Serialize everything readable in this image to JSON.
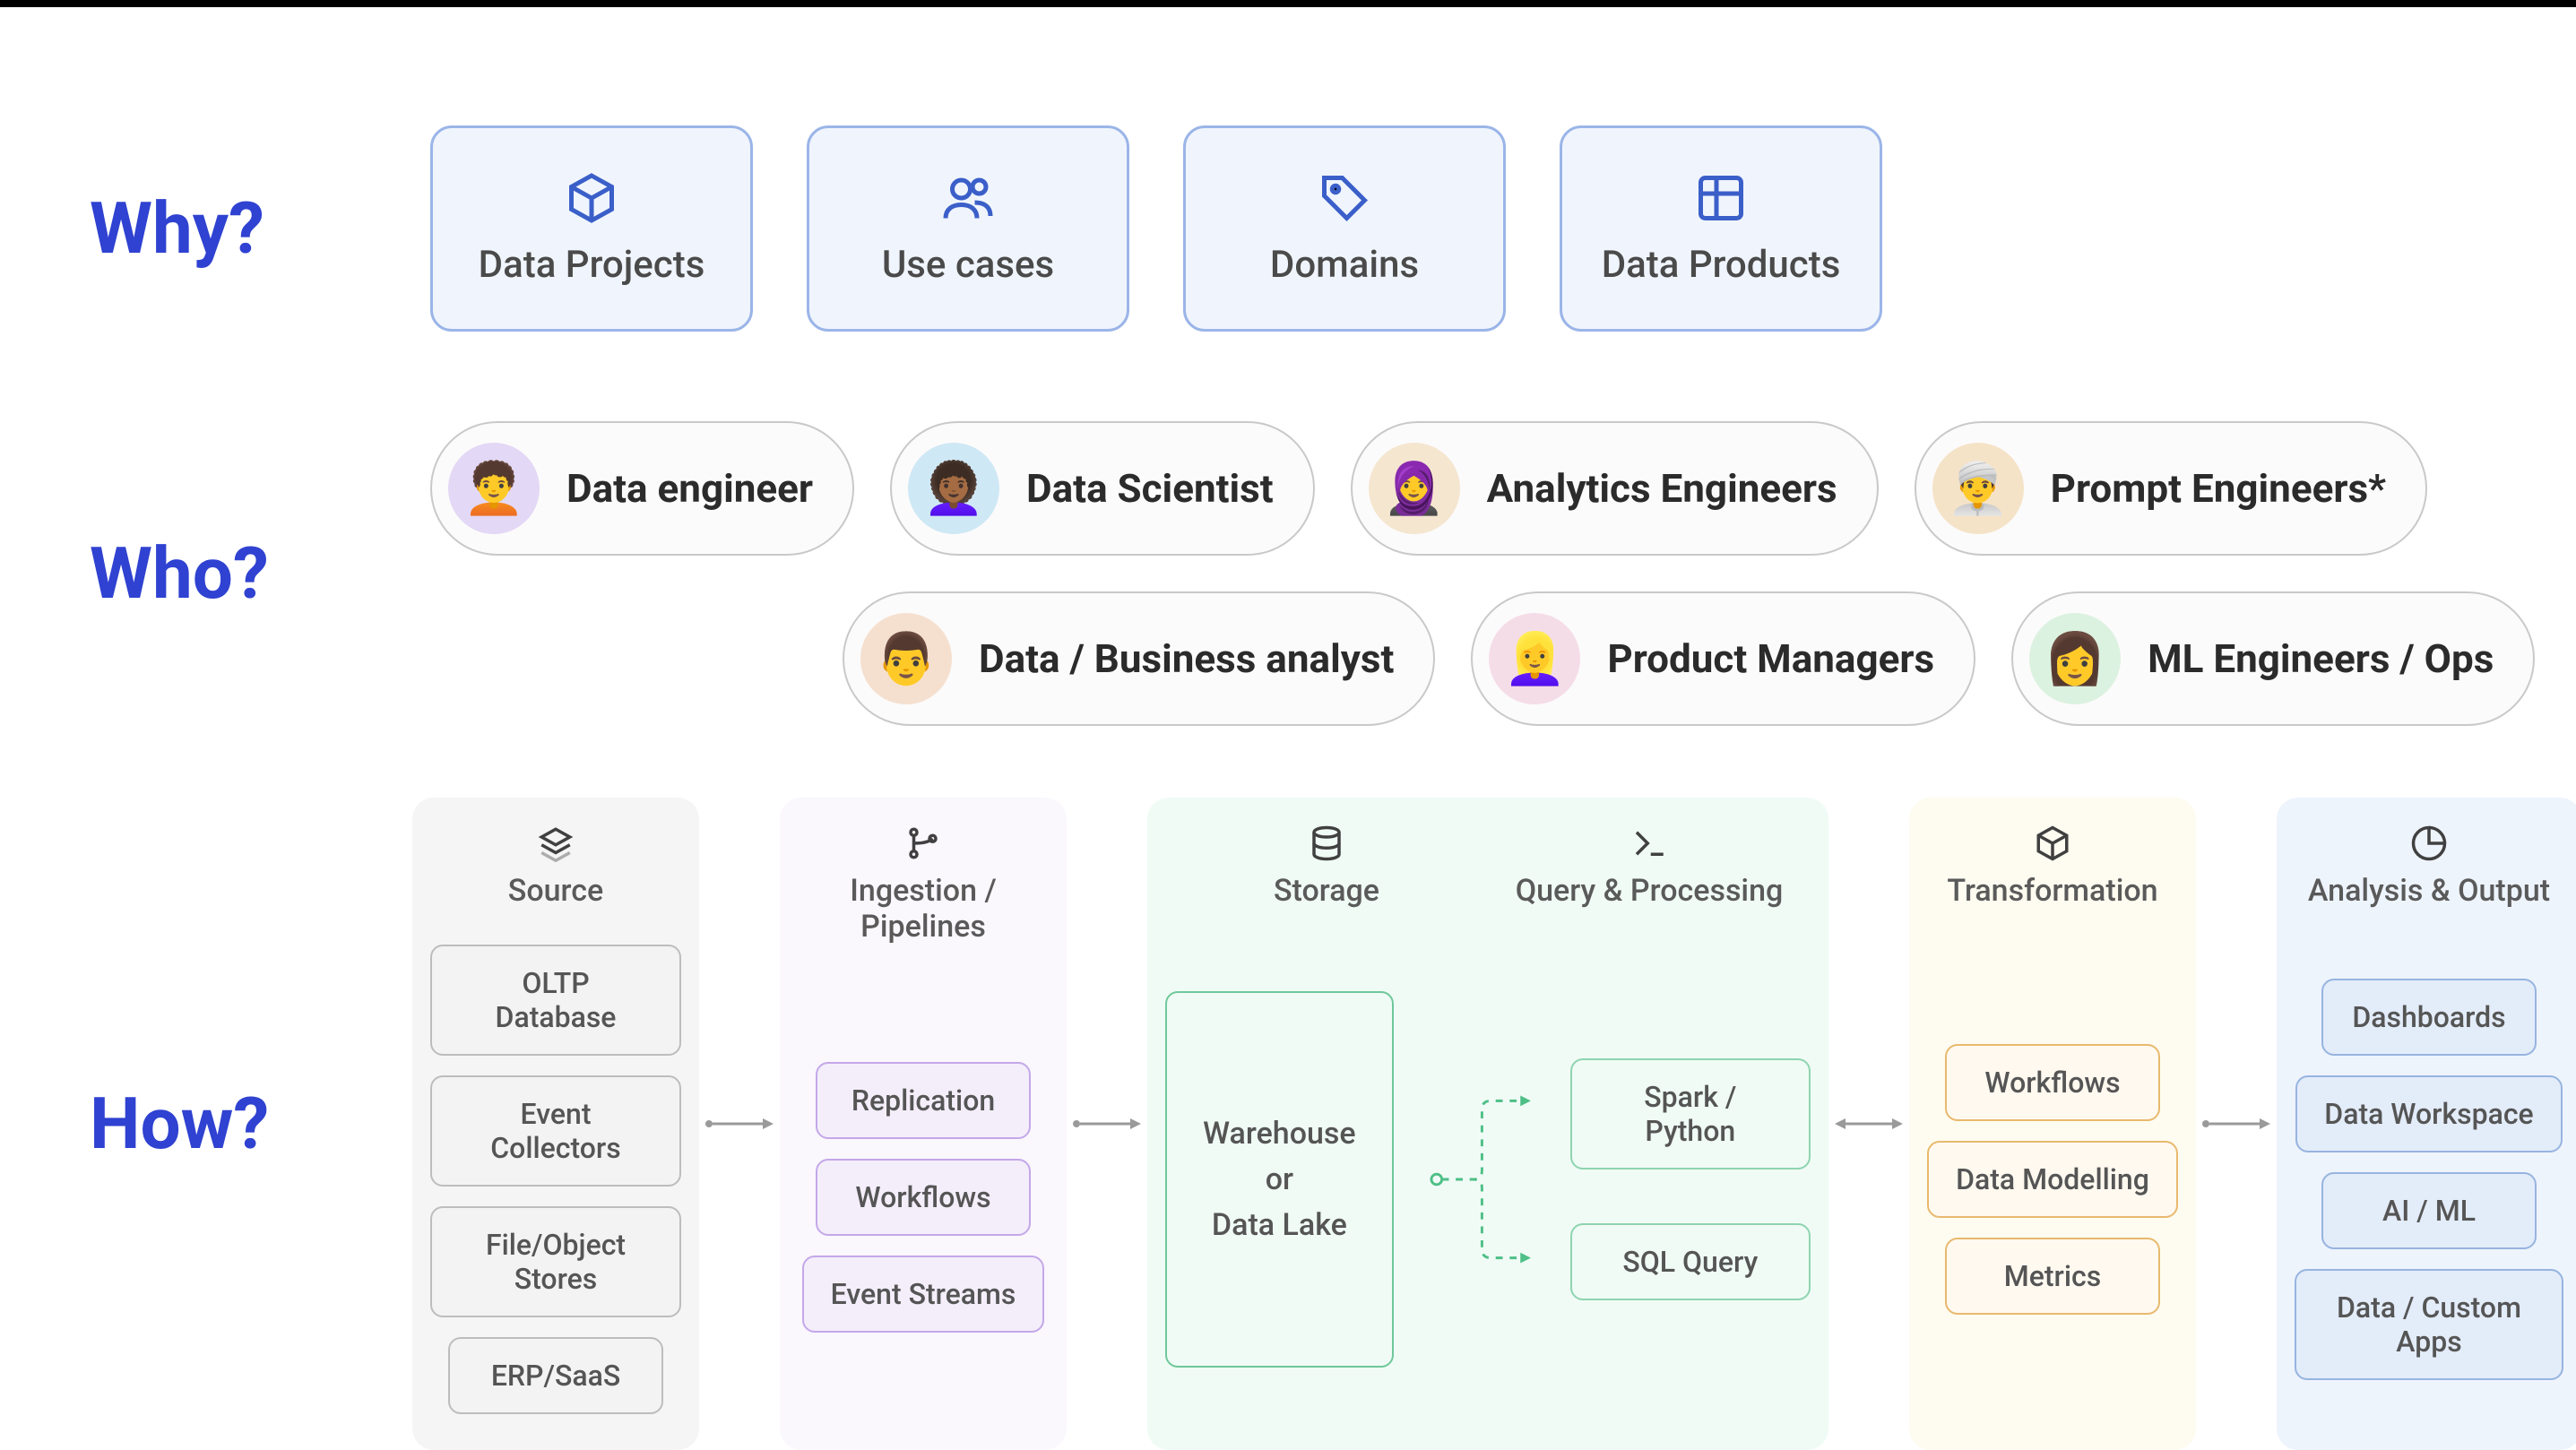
{
  "labels": {
    "why": "Why?",
    "who": "Who?",
    "how": "How?"
  },
  "why": [
    {
      "icon": "cube",
      "label": "Data Projects"
    },
    {
      "icon": "users",
      "label": "Use cases"
    },
    {
      "icon": "tag",
      "label": "Domains"
    },
    {
      "icon": "grid",
      "label": "Data Products"
    }
  ],
  "who_row1": [
    {
      "label": "Data engineer",
      "avatar_bg": "#E3D8F5",
      "emoji": "🧑‍🦱"
    },
    {
      "label": "Data Scientist",
      "avatar_bg": "#CFE8F5",
      "emoji": "👩🏾‍🦱"
    },
    {
      "label": "Analytics Engineers",
      "avatar_bg": "#F5E6D0",
      "emoji": "🧕"
    },
    {
      "label": "Prompt Engineers*",
      "avatar_bg": "#F5E3C8",
      "emoji": "👳‍♂️"
    }
  ],
  "who_row2": [
    {
      "label": "Data / Business analyst",
      "avatar_bg": "#F5E0D0",
      "emoji": "👨"
    },
    {
      "label": "Product Managers",
      "avatar_bg": "#F5DDE8",
      "emoji": "👱‍♀️"
    },
    {
      "label": "ML Engineers / Ops",
      "avatar_bg": "#DCF2E0",
      "emoji": "👩"
    }
  ],
  "how": {
    "source": {
      "title": "Source",
      "icon": "layers",
      "items": [
        "OLTP Database",
        "Event Collectors",
        "File/Object Stores",
        "ERP/SaaS"
      ]
    },
    "ingest": {
      "title": "Ingestion / Pipelines",
      "icon": "branch",
      "items": [
        "Replication",
        "Workflows",
        "Event Streams"
      ]
    },
    "storage": {
      "title": "Storage",
      "icon": "database",
      "big_line1": "Warehouse",
      "big_line2": "or",
      "big_line3": "Data Lake"
    },
    "processing": {
      "title": "Query & Processing",
      "icon": "terminal",
      "items": [
        "Spark / Python",
        "SQL Query"
      ]
    },
    "transform": {
      "title": "Transformation",
      "icon": "cube",
      "items": [
        "Workflows",
        "Data Modelling",
        "Metrics"
      ]
    },
    "output": {
      "title": "Analysis & Output",
      "icon": "piechart",
      "items": [
        "Dashboards",
        "Data Workspace",
        "AI / ML",
        "Data / Custom Apps"
      ]
    }
  }
}
